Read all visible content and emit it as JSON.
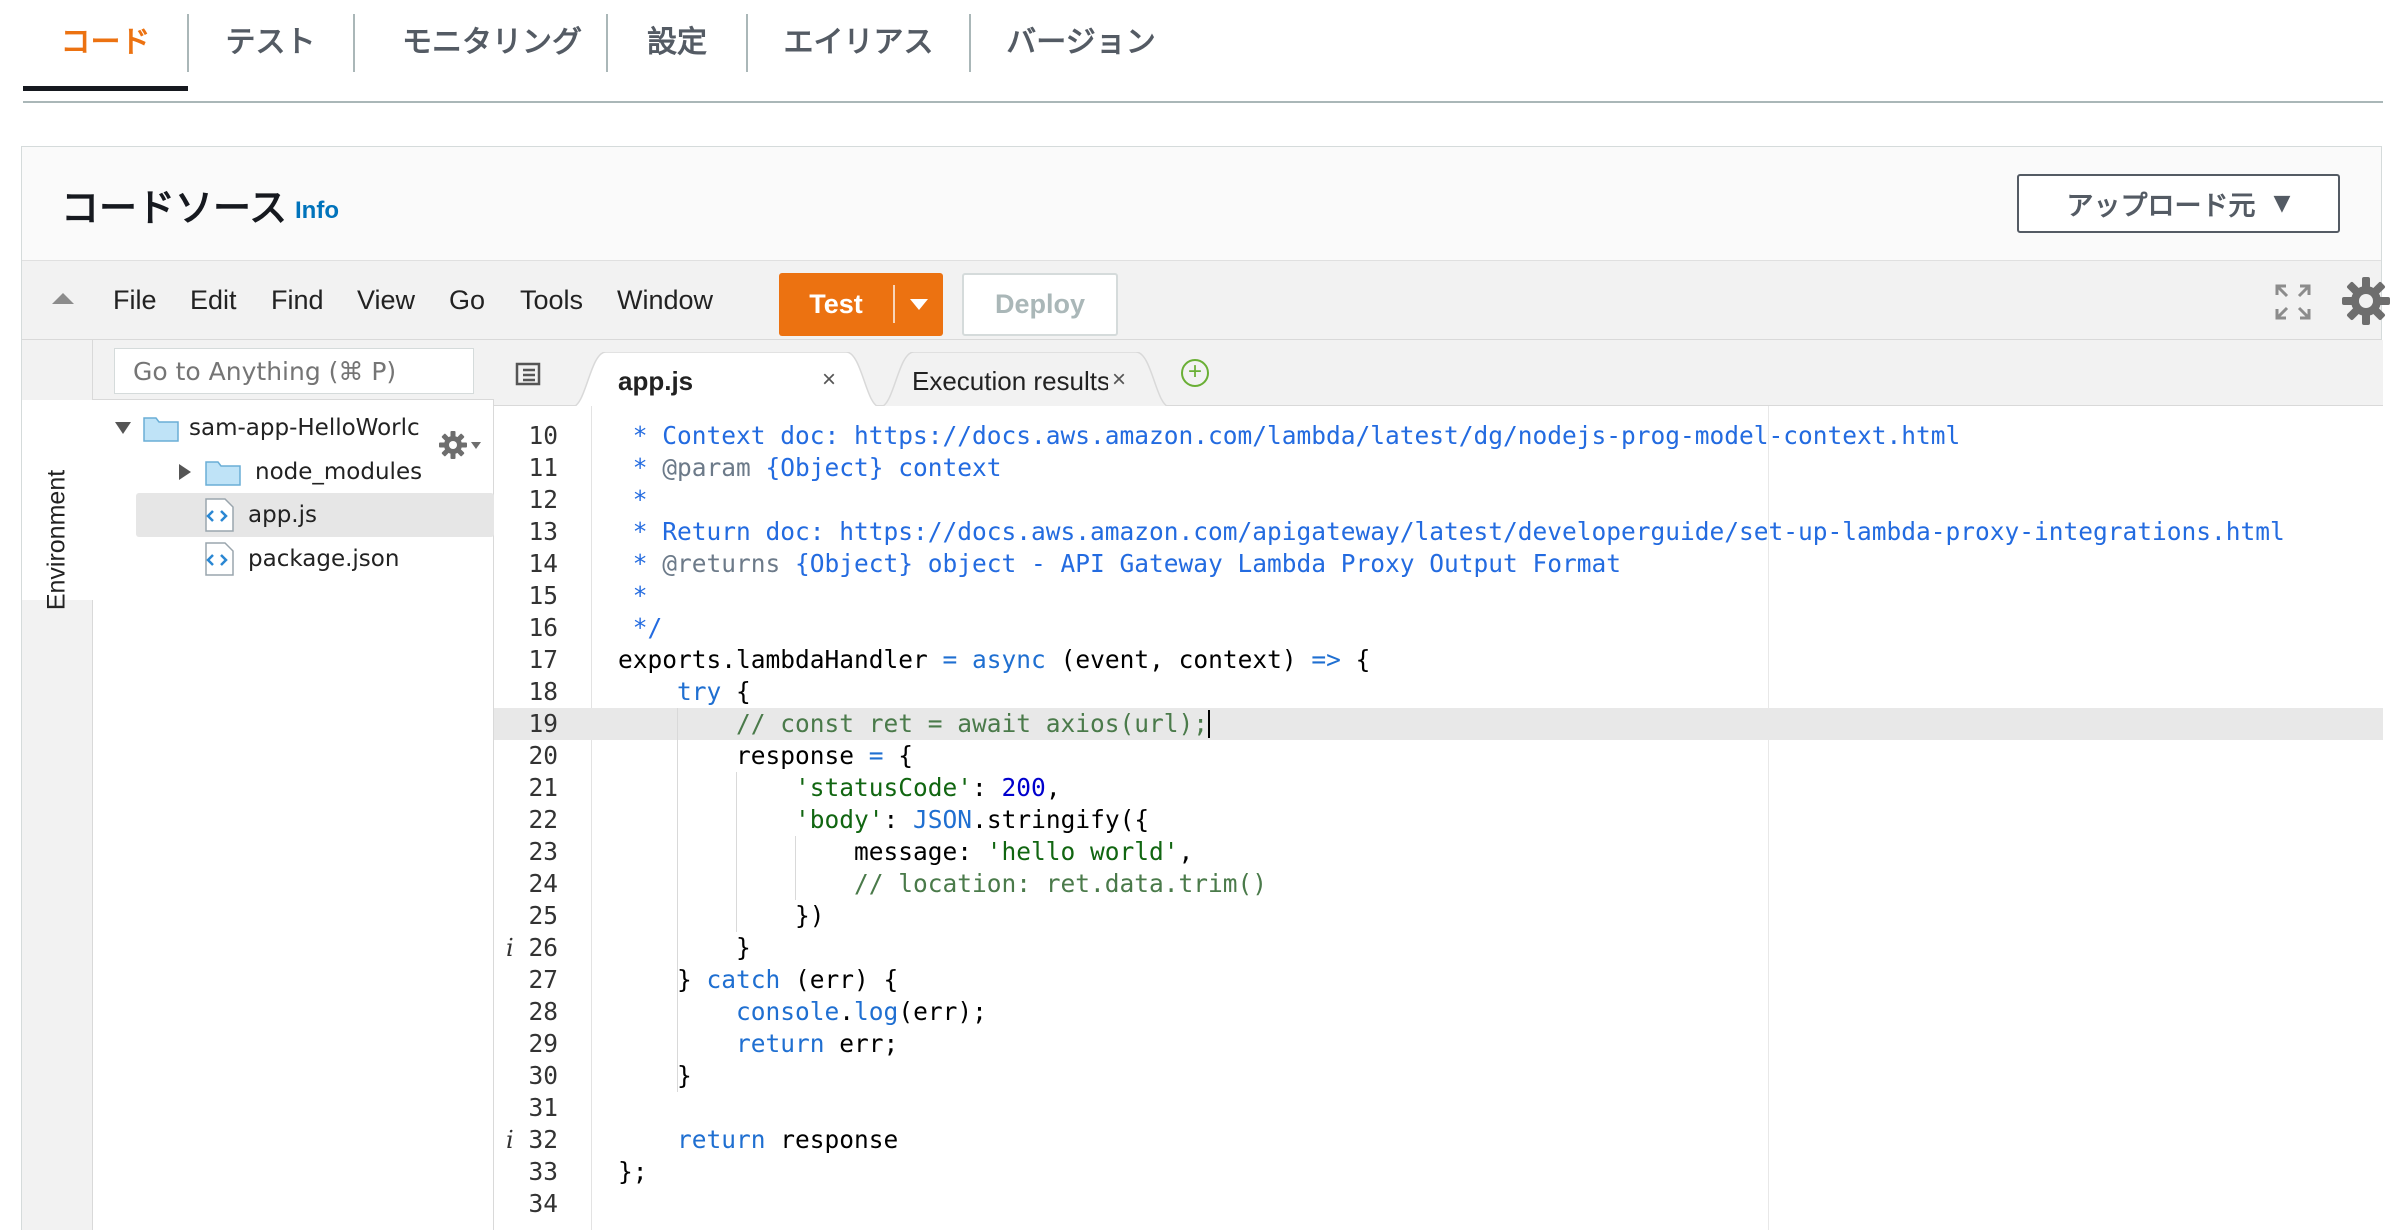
{
  "top_tabs": [
    {
      "label": "コード",
      "active": true
    },
    {
      "label": "テスト",
      "active": false
    },
    {
      "label": "モニタリング",
      "active": false
    },
    {
      "label": "設定",
      "active": false
    },
    {
      "label": "エイリアス",
      "active": false
    },
    {
      "label": "バージョン",
      "active": false
    }
  ],
  "panel": {
    "title": "コードソース",
    "info_label": "Info",
    "upload_label": "アップロード元"
  },
  "menubar": {
    "items": [
      "File",
      "Edit",
      "Find",
      "View",
      "Go",
      "Tools",
      "Window"
    ],
    "test_label": "Test",
    "deploy_label": "Deploy"
  },
  "sidebar": {
    "environment_label": "Environment",
    "search_placeholder": "Go to Anything (⌘ P)",
    "tree": {
      "root": "sam-app-HelloWorlc",
      "items": [
        "node_modules",
        "app.js",
        "package.json"
      ]
    }
  },
  "editor_tabs": [
    {
      "label": "app.js",
      "active": true,
      "close": "×"
    },
    {
      "label": "Execution results",
      "active": false,
      "close": "×"
    }
  ],
  "add_tab_symbol": "+",
  "colors": {
    "accent_orange": "#ec7211",
    "link_blue": "#0073bb",
    "doc_blue": "#236be0",
    "comment_green": "#4a7a4a"
  },
  "code": {
    "active_line": 19,
    "lines": [
      {
        "n": "10",
        "text": " * Context doc: https://docs.aws.amazon.com/lambda/latest/dg/nodejs-prog-model-context.html"
      },
      {
        "n": "11",
        "text": " * @param {Object} context"
      },
      {
        "n": "12",
        "text": " *"
      },
      {
        "n": "13",
        "text": " * Return doc: https://docs.aws.amazon.com/apigateway/latest/developerguide/set-up-lambda-proxy-integrations.html"
      },
      {
        "n": "14",
        "text": " * @returns {Object} object - API Gateway Lambda Proxy Output Format"
      },
      {
        "n": "15",
        "text": " *"
      },
      {
        "n": "16",
        "text": " */"
      },
      {
        "n": "17",
        "text": "exports.lambdaHandler = async (event, context) => {"
      },
      {
        "n": "18",
        "text": "    try {"
      },
      {
        "n": "19",
        "text": "        // const ret = await axios(url);"
      },
      {
        "n": "20",
        "text": "        response = {"
      },
      {
        "n": "21",
        "text": "            'statusCode': 200,"
      },
      {
        "n": "22",
        "text": "            'body': JSON.stringify({"
      },
      {
        "n": "23",
        "text": "                message: 'hello world',"
      },
      {
        "n": "24",
        "text": "                // location: ret.data.trim()"
      },
      {
        "n": "25",
        "text": "            })"
      },
      {
        "n": "26",
        "text": "        }",
        "info": "i"
      },
      {
        "n": "27",
        "text": "    } catch (err) {"
      },
      {
        "n": "28",
        "text": "        console.log(err);"
      },
      {
        "n": "29",
        "text": "        return err;"
      },
      {
        "n": "30",
        "text": "    }"
      },
      {
        "n": "31",
        "text": ""
      },
      {
        "n": "32",
        "text": "    return response",
        "info": "i"
      },
      {
        "n": "33",
        "text": "};"
      },
      {
        "n": "34",
        "text": ""
      }
    ]
  }
}
